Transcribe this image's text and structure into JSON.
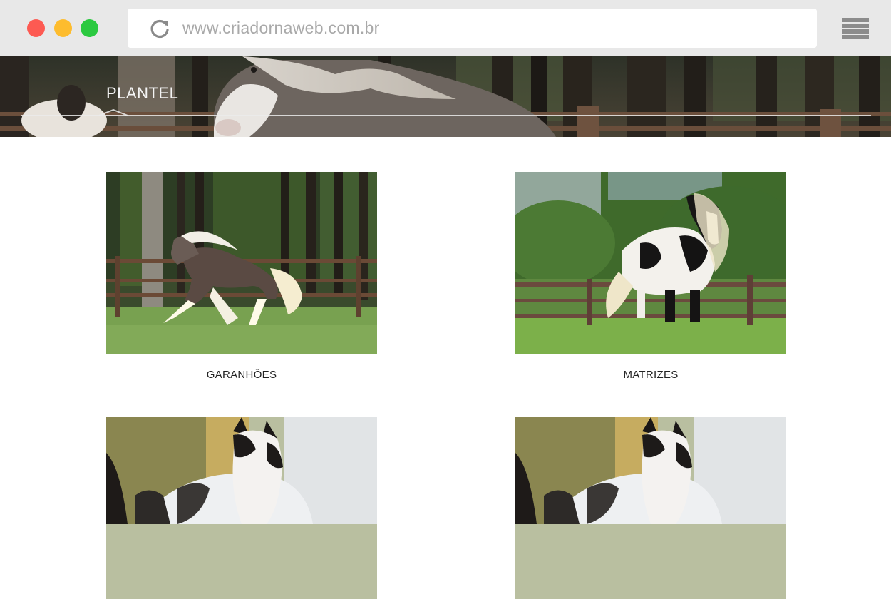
{
  "browser": {
    "url": "www.criadornaweb.com.br",
    "icons": {
      "reload": "reload-icon",
      "menu": "hamburger-menu-icon"
    },
    "colors": {
      "close": "#fd5a52",
      "minimize": "#fdbc2e",
      "maximize": "#2bc940"
    }
  },
  "hero": {
    "title": "PLANTEL"
  },
  "cards": [
    {
      "label": "GARANHÕES",
      "image": "grey-stallion-trotting-in-paddock"
    },
    {
      "label": "MATRIZES",
      "image": "black-white-pinto-mare-in-paddock"
    },
    {
      "label": "",
      "image": "pinto-foal-portrait"
    },
    {
      "label": "",
      "image": "pinto-foal-portrait"
    }
  ]
}
